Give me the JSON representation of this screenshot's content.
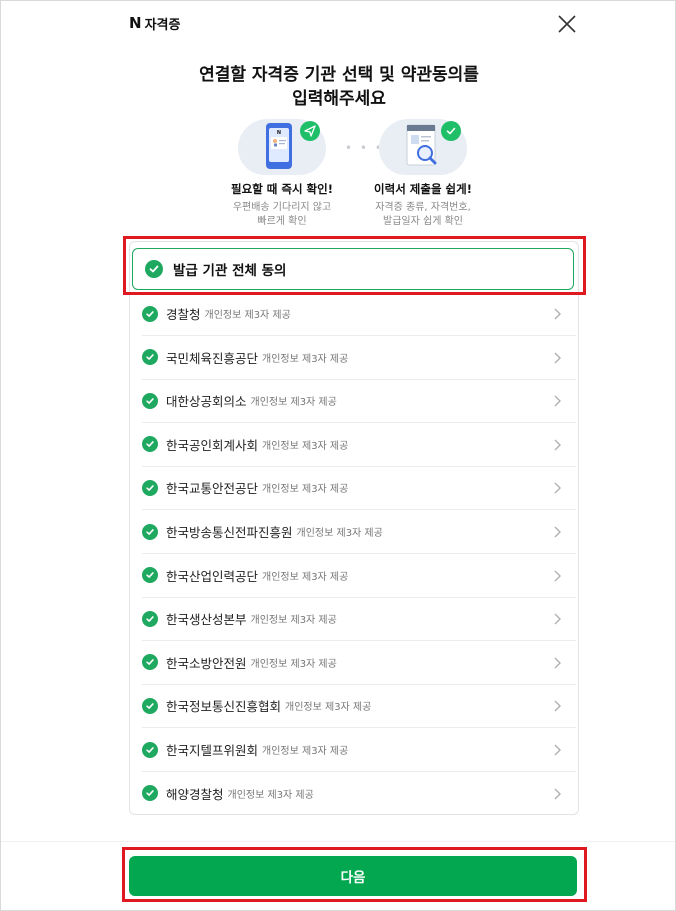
{
  "header": {
    "brand_logo": "N",
    "brand_title": "자격증"
  },
  "title": {
    "line1": "연결할 자격증 기관 선택 및 약관동의를",
    "line2": "입력해주세요"
  },
  "features": [
    {
      "title": "필요할 때 즉시 확인!",
      "desc1": "우편배송 기다리지 않고",
      "desc2": "빠르게 확인",
      "icon": "phone-id-card-icon"
    },
    {
      "title": "이력서 제출을 쉽게!",
      "desc1": "자격증 종류, 자격번호,",
      "desc2": "발급일자 쉽게 확인",
      "icon": "document-magnifier-icon"
    }
  ],
  "all_agree": {
    "label": "발급 기관 전체 동의",
    "checked": true
  },
  "agencies": [
    {
      "name": "경찰청",
      "sub": "개인정보 제3자 제공"
    },
    {
      "name": "국민체육진흥공단",
      "sub": "개인정보 제3자 제공"
    },
    {
      "name": "대한상공회의소",
      "sub": "개인정보 제3자 제공"
    },
    {
      "name": "한국공인회계사회",
      "sub": "개인정보 제3자 제공"
    },
    {
      "name": "한국교통안전공단",
      "sub": "개인정보 제3자 제공"
    },
    {
      "name": "한국방송통신전파진흥원",
      "sub": "개인정보 제3자 제공"
    },
    {
      "name": "한국산업인력공단",
      "sub": "개인정보 제3자 제공"
    },
    {
      "name": "한국생산성본부",
      "sub": "개인정보 제3자 제공"
    },
    {
      "name": "한국소방안전원",
      "sub": "개인정보 제3자 제공"
    },
    {
      "name": "한국정보통신진흥협회",
      "sub": "개인정보 제3자 제공"
    },
    {
      "name": "한국지텔프위원회",
      "sub": "개인정보 제3자 제공"
    },
    {
      "name": "해양경찰청",
      "sub": "개인정보 제3자 제공"
    }
  ],
  "footer": {
    "next_label": "다음"
  },
  "colors": {
    "accent": "#03a74f",
    "check": "#1fa85f",
    "highlight": "#e0181f"
  }
}
